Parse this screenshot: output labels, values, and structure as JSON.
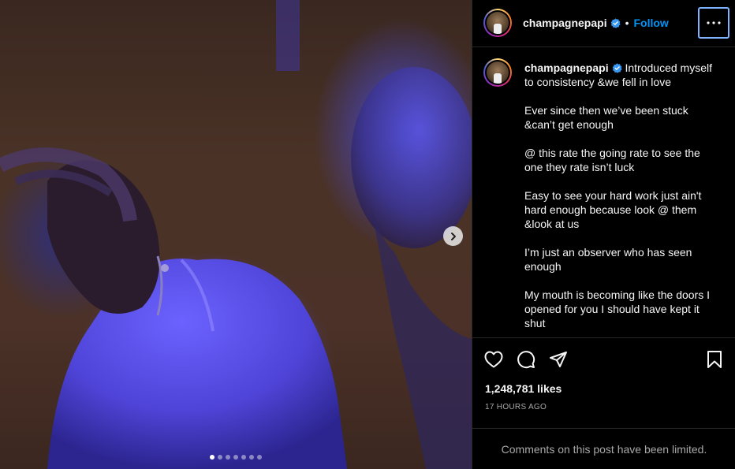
{
  "post": {
    "username": "champagnepapi",
    "follow_label": "Follow",
    "separator": "•",
    "caption": "Introduced myself to consistency &we fell in love\n\nEver since then we’ve been stuck &can’t get enough\n\n@ this rate the going rate to see the one they rate isn’t luck\n\nEasy to see your hard work just ain't hard enough because look @ them &look at us\n\nI’m just an observer who has seen enough\n\nMy mouth is becoming like the doors I opened for you I should have kept it shut",
    "likes": "1,248,781 likes",
    "timestamp": "17 HOURS AGO",
    "comments_notice": "Comments on this post have been limited."
  },
  "carousel": {
    "slide_count": 7,
    "active_index": 0
  },
  "colors": {
    "accent": "#0095f6",
    "verified": "#3897f0",
    "muted": "#a8a8a8",
    "divider": "#262626"
  },
  "icons": {
    "like": "heart-icon",
    "comment": "comment-icon",
    "share": "share-icon",
    "save": "bookmark-icon",
    "more": "more-icon",
    "next": "chevron-right-icon",
    "verified": "verified-badge-icon"
  }
}
